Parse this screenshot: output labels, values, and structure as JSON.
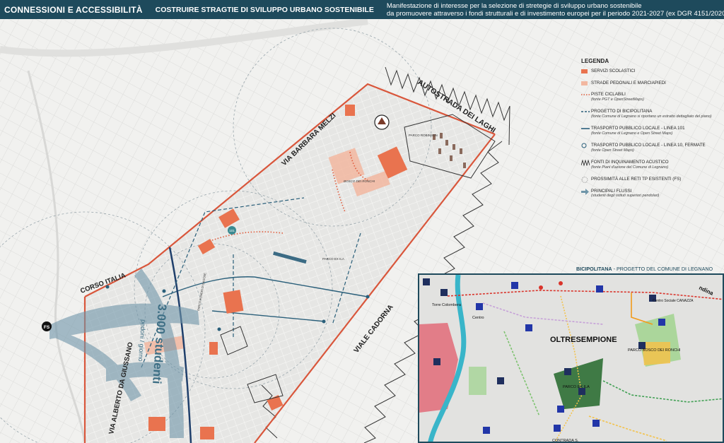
{
  "header": {
    "title": "CONNESSIONI E ACCESSIBILITÀ",
    "subtitle": "COSTRUIRE STRAGTIE DI SVILUPPO URBANO SOSTENIBILE",
    "description_line1": "Manifestazione di interesse per la selezione di stretegie di sviluppo urbano sostenibile",
    "description_line2": "da promuovere attraverso i fondi strutturali e di investimento europei per il periodo 2021-2027 (ex DGR 4151/2020)"
  },
  "map_labels": {
    "autostrada": "AUTOSTRADA DEI LAGHI",
    "via_barbara": "VIA BARBARA MELZI",
    "corso_italia": "CORSO ITALIA",
    "viale_cadorna": "VIALE CADORNA",
    "via_giussano": "VIA ALBERTO DA GIUSSANO",
    "students": "3.000 studenti",
    "pedoni": "pedoni / giorno",
    "parco_robinson": "PARCO ROBINSON",
    "bosco_ronchi": "BOSCO DEI RONCHI",
    "parco_ila": "PARCO EX ILA",
    "parco_ex_dell": "PARCO ROMERI DI DAGOSE",
    "fs": "FS",
    "stop_label": "101"
  },
  "legend": {
    "title": "LEGENDA",
    "items": [
      {
        "label": "Servizi scolastici",
        "note": "",
        "icon": "school-area-swatch"
      },
      {
        "label": "Strade pedonali e marciapiedi",
        "note": "",
        "icon": "pedestrian-swatch"
      },
      {
        "label": "Piste ciclabili",
        "note": "(fonte PGT e OpenStreetMaps)",
        "icon": "cycle-dotted-line"
      },
      {
        "label": "Progetto di Bicipolitana",
        "note": "(fonte Comune di Legnano si riportano un estratto dettagliato del piano)",
        "icon": "bicipolitana-dashed-line"
      },
      {
        "label": "Trasporto pubblico locale - linea 101",
        "note": "(fonte Comune di Legnano e Open Street Maps)",
        "icon": "bus-line"
      },
      {
        "label": "Trasporto pubblico locale - linea 10, fermate",
        "note": "(fonte Open Street Maps)",
        "icon": "bus-stop-circle"
      },
      {
        "label": "Fonti di inquinamento acustico",
        "note": "(fonte Piani d'azione del Comune di Legnano)",
        "icon": "noise-zigzag"
      },
      {
        "label": "Prossimità alle reti TP esistenti (FS)",
        "note": "",
        "icon": "proximity-circle"
      },
      {
        "label": "Principali flussi",
        "note": "(studenti degli istituti superiori pendolari)",
        "icon": "flow-arrow"
      }
    ]
  },
  "inset": {
    "title_bold": "BICIPOLITANA",
    "title_rest": " - PROGETTO DEL COMUNE DI LEGNANO",
    "labels": {
      "oltresempione": "OLTRESEMPIONE",
      "parco_bosco": "PARCO BOSCO DEI RONCHI",
      "parco_ila": "PARCO EX ILA",
      "torre": "Torre Colombera",
      "centro": "Centro",
      "castello": "Centro Sociale CANAZZA",
      "contrada": "CONTRADA S.",
      "ndina": "ndina"
    }
  },
  "colors": {
    "header_bg": "#1e4a5c",
    "school": "#e9734f",
    "pedestrian": "#f2b7a0",
    "cycle": "#e05a3a",
    "bus": "#2a5f7a",
    "noise": "#333333",
    "flow": "#6f95a8"
  }
}
